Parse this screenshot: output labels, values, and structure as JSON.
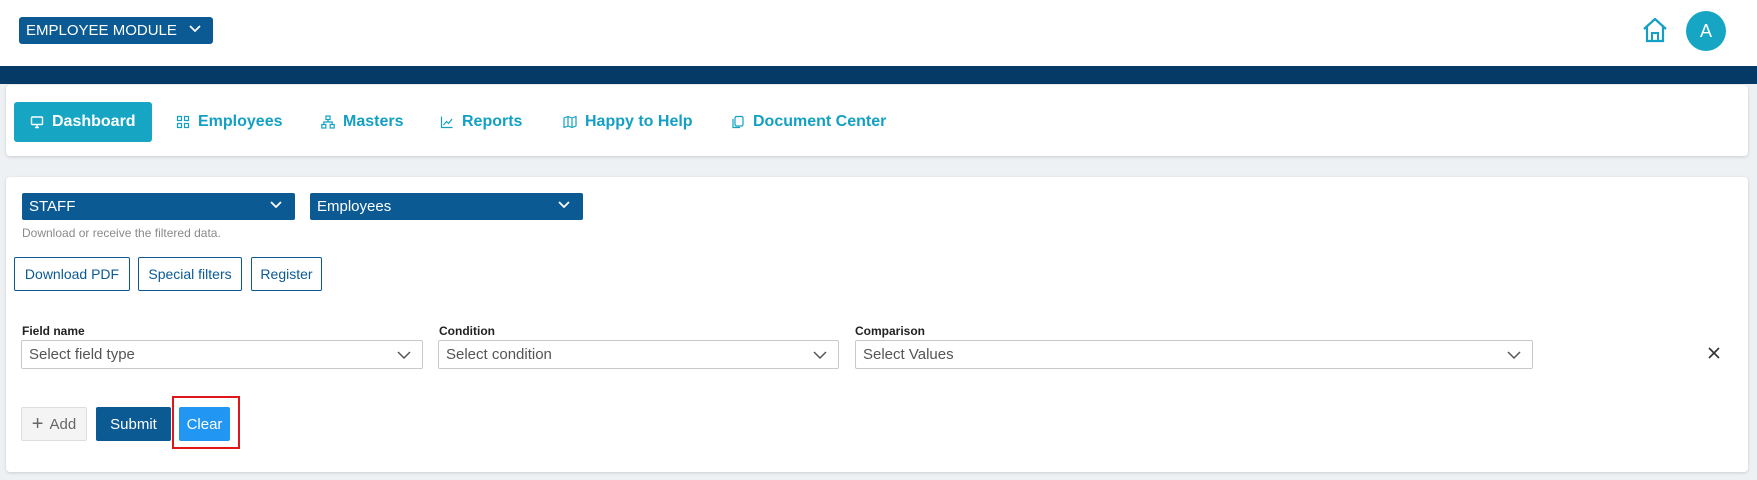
{
  "header": {
    "module_label": "EMPLOYEE MODULE",
    "avatar_initial": "A"
  },
  "nav": {
    "items": [
      {
        "label": "Dashboard",
        "icon": "monitor-icon",
        "active": true
      },
      {
        "label": "Employees",
        "icon": "grid-icon"
      },
      {
        "label": "Masters",
        "icon": "sitemap-icon"
      },
      {
        "label": "Reports",
        "icon": "line-chart-icon"
      },
      {
        "label": "Happy to Help",
        "icon": "map-icon"
      },
      {
        "label": "Document Center",
        "icon": "documents-icon"
      }
    ]
  },
  "filters": {
    "category_value": "STAFF",
    "type_value": "Employees",
    "hint": "Download or receive the filtered data."
  },
  "actions": {
    "download_pdf": "Download PDF",
    "special_filters": "Special filters",
    "register": "Register"
  },
  "criteria": {
    "field_name_label": "Field name",
    "field_name_placeholder": "Select field type",
    "condition_label": "Condition",
    "condition_placeholder": "Select condition",
    "comparison_label": "Comparison",
    "comparison_placeholder": "Select Values"
  },
  "buttons": {
    "add": "Add",
    "submit": "Submit",
    "clear": "Clear"
  },
  "colors": {
    "navy": "#063a66",
    "primary": "#0b5a94",
    "accent": "#16a6c4",
    "clear_button": "#2196f3",
    "highlight": "#e0161b"
  }
}
